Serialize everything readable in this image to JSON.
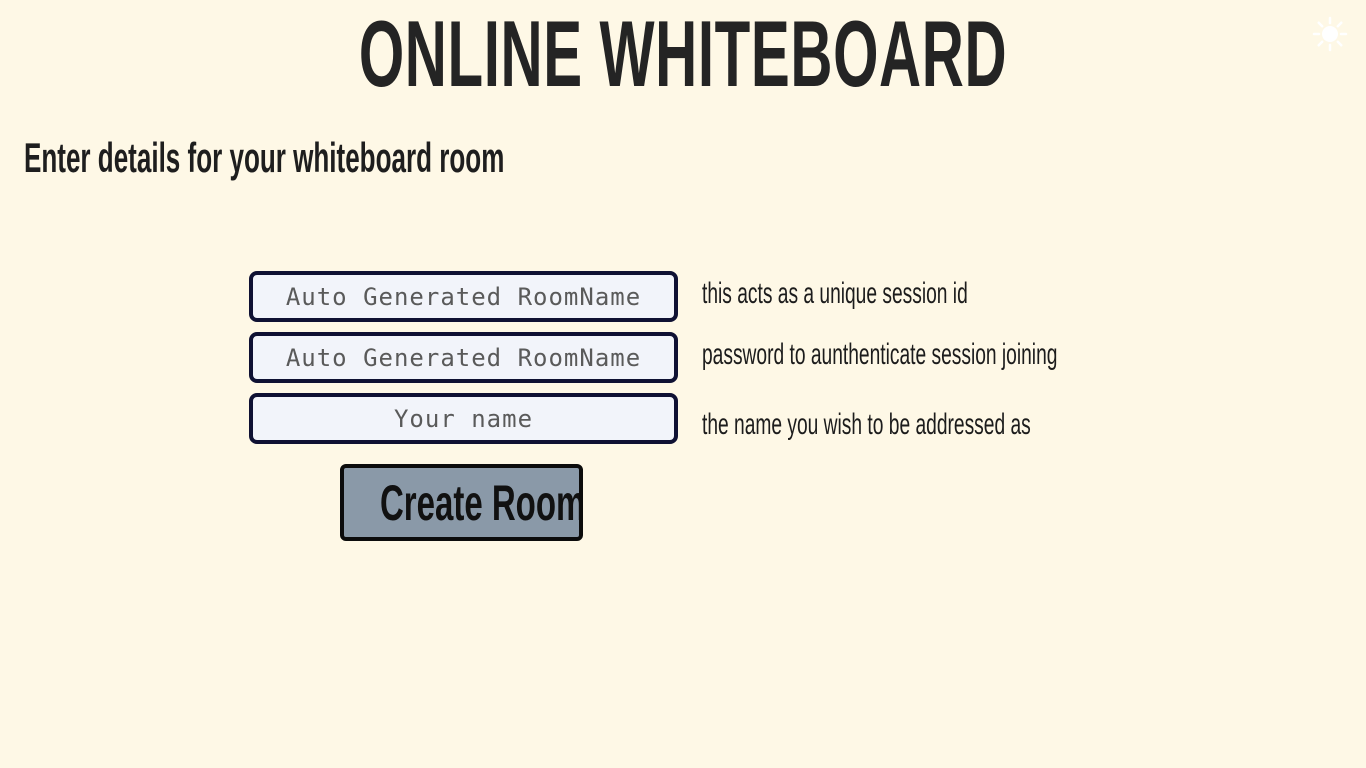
{
  "header": {
    "title": "ONLINE WHITEBOARD",
    "theme_toggle_icon": "sun-icon"
  },
  "form": {
    "subtitle": "Enter details for your whiteboard room",
    "fields": [
      {
        "placeholder": "Auto Generated RoomName",
        "value": "",
        "hint": "this acts as a unique session id"
      },
      {
        "placeholder": "Auto Generated RoomName",
        "value": "",
        "hint": "password to aunthenticate session joining"
      },
      {
        "placeholder": "Your name",
        "value": "",
        "hint": "the name you wish to be addressed as"
      }
    ],
    "submit_label": "Create Room"
  },
  "colors": {
    "background": "#fef8e6",
    "field_border": "#0f1133",
    "field_background": "#f2f4fa",
    "button_background": "#8a99a8"
  }
}
